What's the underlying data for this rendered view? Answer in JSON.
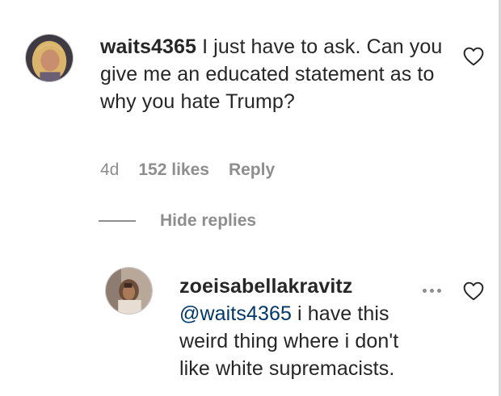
{
  "comment": {
    "username": "waits4365",
    "text": "I just have to ask. Can you give me an educated statement as to why you hate Trump?",
    "time": "4d",
    "likes": "152 likes",
    "reply_label": "Reply"
  },
  "thread": {
    "hide_replies_label": "Hide replies"
  },
  "reply": {
    "username": "zoeisabellakravitz",
    "mention": "@waits4365",
    "text": "i have this weird thing where i don't like white supremacists."
  },
  "icons": {
    "like": "heart-outline-icon",
    "more": "more-options-icon"
  },
  "colors": {
    "text": "#262626",
    "secondary": "#8e8e8e",
    "mention": "#00376b"
  }
}
